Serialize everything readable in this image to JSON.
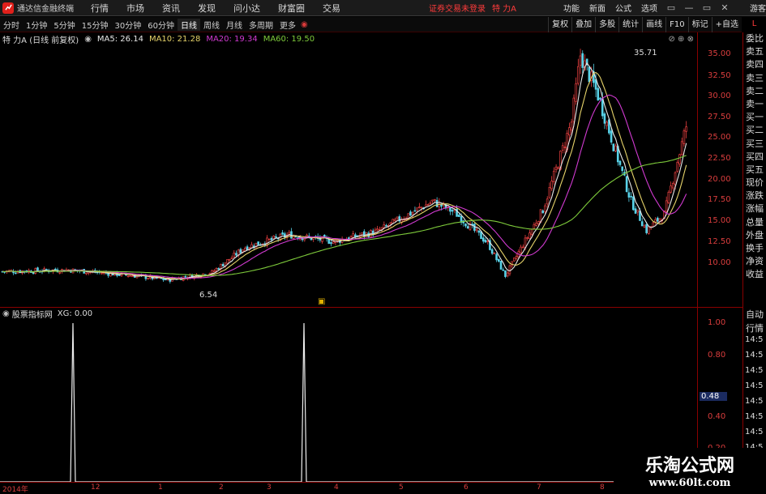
{
  "app": {
    "name": "通达信金融终端",
    "menus": [
      "行情",
      "市场",
      "资讯",
      "发现",
      "问小达",
      "财富圈",
      "交易"
    ],
    "login_warning": "证券交易未登录",
    "stock_name": "特 力A",
    "right_menus": [
      "功能",
      "新面",
      "公式",
      "选项"
    ],
    "user": "游客",
    "win": [
      "▭",
      "—",
      "▭",
      "✕"
    ]
  },
  "periods": [
    "分时",
    "1分钟",
    "5分钟",
    "15分钟",
    "30分钟",
    "60分钟",
    "日线",
    "周线",
    "月线",
    "多周期",
    "更多"
  ],
  "active_period": "日线",
  "toolbar_right": [
    "复权",
    "叠加",
    "多股",
    "统计",
    "画线",
    "F10",
    "标记",
    "+自选"
  ],
  "side_top": "L",
  "legend": {
    "title": "特 力A (日线 前复权)",
    "items": [
      {
        "text": "MA5: 26.14",
        "color": "#e8e8e8"
      },
      {
        "text": "MA10: 21.28",
        "color": "#e6d36a"
      },
      {
        "text": "MA20: 19.34",
        "color": "#d13ad1"
      },
      {
        "text": "MA60: 19.50",
        "color": "#7ecb3b"
      }
    ]
  },
  "yaxis": [
    "35.00",
    "32.50",
    "30.00",
    "27.50",
    "25.00",
    "22.50",
    "20.00",
    "17.50",
    "15.00",
    "12.50",
    "10.00"
  ],
  "side_items": [
    "委比",
    "卖五",
    "卖四",
    "卖三",
    "卖二",
    "卖一",
    "买一",
    "买二",
    "买三",
    "买四",
    "买五",
    "现价",
    "涨跌",
    "涨幅",
    "总量",
    "外盘",
    "换手",
    "净资",
    "收益"
  ],
  "price_marks": {
    "high": "35.71",
    "low": "6.54"
  },
  "event_marker": "▣",
  "indicator": {
    "title": "股票指标网",
    "value": "XG: 0.00"
  },
  "iyaxis": [
    "1.00",
    "0.80",
    "0.48",
    "0.40",
    "0.20"
  ],
  "iside": [
    "自动",
    "行情",
    "14:5",
    "14:5",
    "14:5",
    "14:5",
    "14:5",
    "14:5",
    "14:5",
    "14:5",
    "14:5",
    "14:5"
  ],
  "xaxis": [
    "2014年",
    "12",
    "1",
    "2",
    "3",
    "4",
    "5",
    "6",
    "7",
    "8"
  ],
  "watermark": {
    "line1": "乐淘公式网",
    "line2": "www.60lt.com"
  },
  "chart_data": {
    "type": "candlestick",
    "high": 35.71,
    "low": 6.54,
    "ma_final": {
      "MA5": 26.14,
      "MA10": 21.28,
      "MA20": 19.34,
      "MA60": 19.5
    },
    "indicator_series": {
      "name": "XG",
      "spikes_at": [
        "12",
        "4"
      ],
      "value": 1.0,
      "current": 0.0
    }
  }
}
